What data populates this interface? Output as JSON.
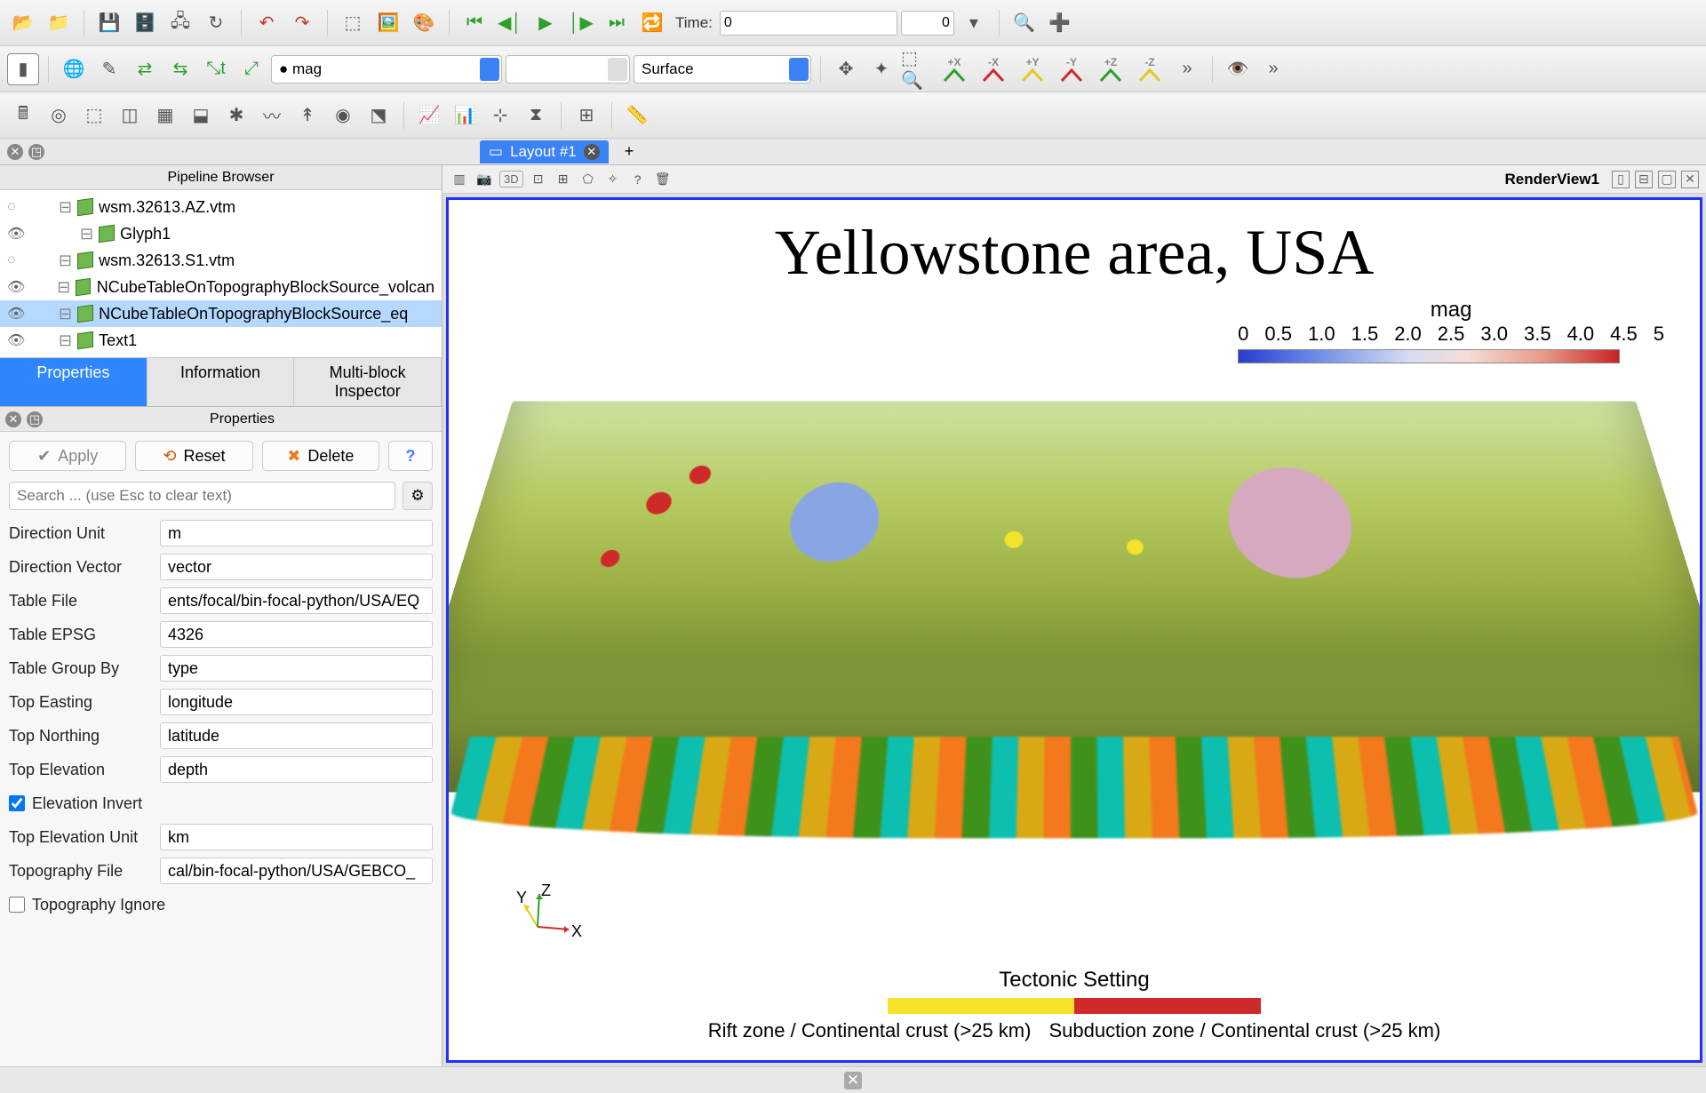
{
  "toolbar": {
    "time_label": "Time:",
    "time_value": "0",
    "time_max": "0",
    "array_select": "● mag",
    "repr_select": "Surface",
    "axis_buttons": [
      "+X",
      "-X",
      "+Y",
      "-Y",
      "+Z",
      "-Z"
    ],
    "chevron": "»"
  },
  "pipeline": {
    "title": "Pipeline Browser",
    "items": [
      {
        "label": "wsm.32613.AZ.vtm",
        "vis": "dim",
        "indent": 24
      },
      {
        "label": "Glyph1",
        "vis": "on",
        "indent": 48
      },
      {
        "label": "wsm.32613.S1.vtm",
        "vis": "dim",
        "indent": 24
      },
      {
        "label": "NCubeTableOnTopographyBlockSource_volcan",
        "vis": "on",
        "indent": 24
      },
      {
        "label": "NCubeTableOnTopographyBlockSource_eq",
        "vis": "on",
        "indent": 24,
        "selected": true
      },
      {
        "label": "Text1",
        "vis": "on",
        "indent": 24
      }
    ]
  },
  "tabs": {
    "properties": "Properties",
    "information": "Information",
    "multiblock": "Multi-block Inspector"
  },
  "properties_panel": {
    "title": "Properties",
    "apply": "Apply",
    "reset": "Reset",
    "delete": "Delete",
    "help": "?",
    "search_placeholder": "Search ... (use Esc to clear text)",
    "rows": [
      {
        "label": "Direction Unit",
        "value": "m"
      },
      {
        "label": "Direction Vector",
        "value": "vector"
      },
      {
        "label": "Table File",
        "value": "ents/focal/bin-focal-python/USA/EQ"
      },
      {
        "label": "Table EPSG",
        "value": "4326"
      },
      {
        "label": "Table Group By",
        "value": "type"
      },
      {
        "label": "Top Easting",
        "value": "longitude"
      },
      {
        "label": "Top Northing",
        "value": "latitude"
      },
      {
        "label": "Top Elevation",
        "value": "depth"
      }
    ],
    "elev_invert": {
      "label": "Elevation Invert",
      "checked": true
    },
    "rows2": [
      {
        "label": "Top Elevation Unit",
        "value": "km"
      },
      {
        "label": "Topography File",
        "value": "cal/bin-focal-python/USA/GEBCO_"
      }
    ],
    "topo_ignore": {
      "label": "Topography Ignore",
      "checked": false
    }
  },
  "layout": {
    "tab": "Layout #1",
    "add": "+"
  },
  "renderview": {
    "label": "RenderView1",
    "btn3d": "3D"
  },
  "viewport": {
    "title": "Yellowstone area, USA",
    "legend_title": "mag",
    "legend_ticks": [
      "0",
      "0.5",
      "1.0",
      "1.5",
      "2.0",
      "2.5",
      "3.0",
      "3.5",
      "4.0",
      "4.5",
      "5"
    ],
    "tectonic_title": "Tectonic Setting",
    "tectonic_labels": [
      "Rift zone / Continental crust (>25 km)",
      "Subduction zone / Continental crust (>25 km)"
    ],
    "axes": {
      "x": "X",
      "y": "Y",
      "z": "Z"
    }
  }
}
